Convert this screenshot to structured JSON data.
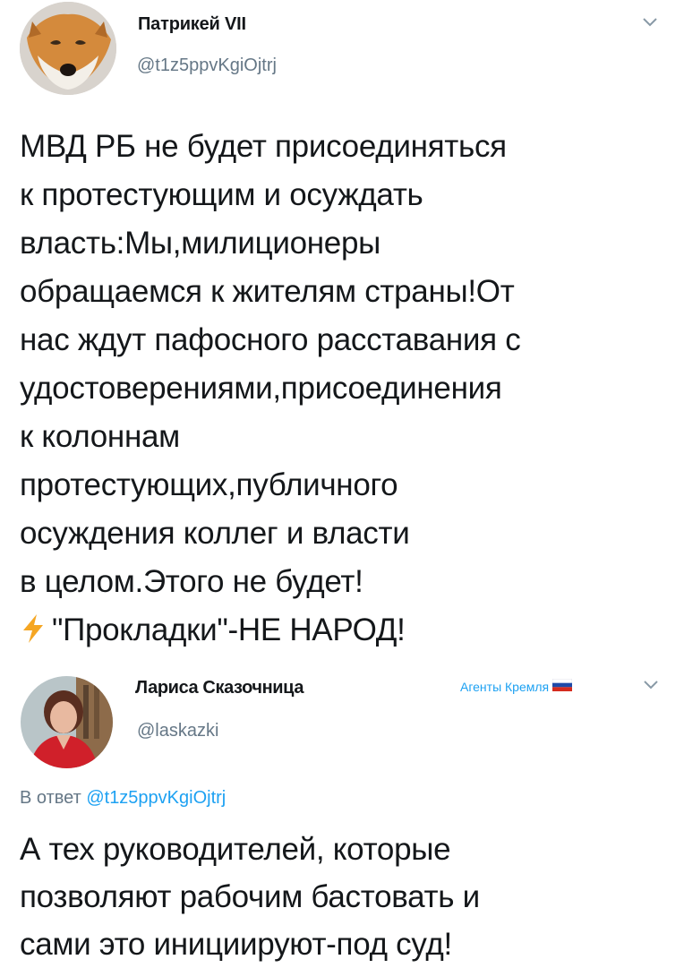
{
  "tweet1": {
    "author_name": "Патрикей VII",
    "author_handle": "@t1z5ppvKgiOjtrj",
    "avatar_icon": "fox-avatar",
    "menu_icon": "chevron-down-icon",
    "body": "МВД РБ не будет присоединяться\nк протестующим и осуждать\nвласть:Мы,милиционеры\nобращаемся к жителям страны!От\nнас ждут пафосного расставания с\nудостоверениями,присоединения\nк колоннам\nпротестующих,публичного\nосуждения коллег и власти\nв целом.Этого не будет!",
    "last_line_icon": "lightning-icon",
    "last_line": "\"Прокладки\"-НЕ НАРОД!"
  },
  "tweet2": {
    "author_name": "Лариса Сказочница",
    "author_handle": "@laskazki",
    "avatar_icon": "woman-portrait-avatar",
    "tagline": "Агенты Кремля",
    "tagline_icon": "russian-flag-icon",
    "menu_icon": "chevron-down-icon",
    "reply_prefix": "В ответ",
    "reply_to": "@t1z5ppvKgiOjtrj",
    "body": "А тех руководителей, которые\nпозволяют рабочим бастовать и\nсами это инициируют-под суд!"
  },
  "colors": {
    "text": "#14171a",
    "secondary": "#657786",
    "link": "#1da1f2",
    "background": "#ffffff"
  }
}
